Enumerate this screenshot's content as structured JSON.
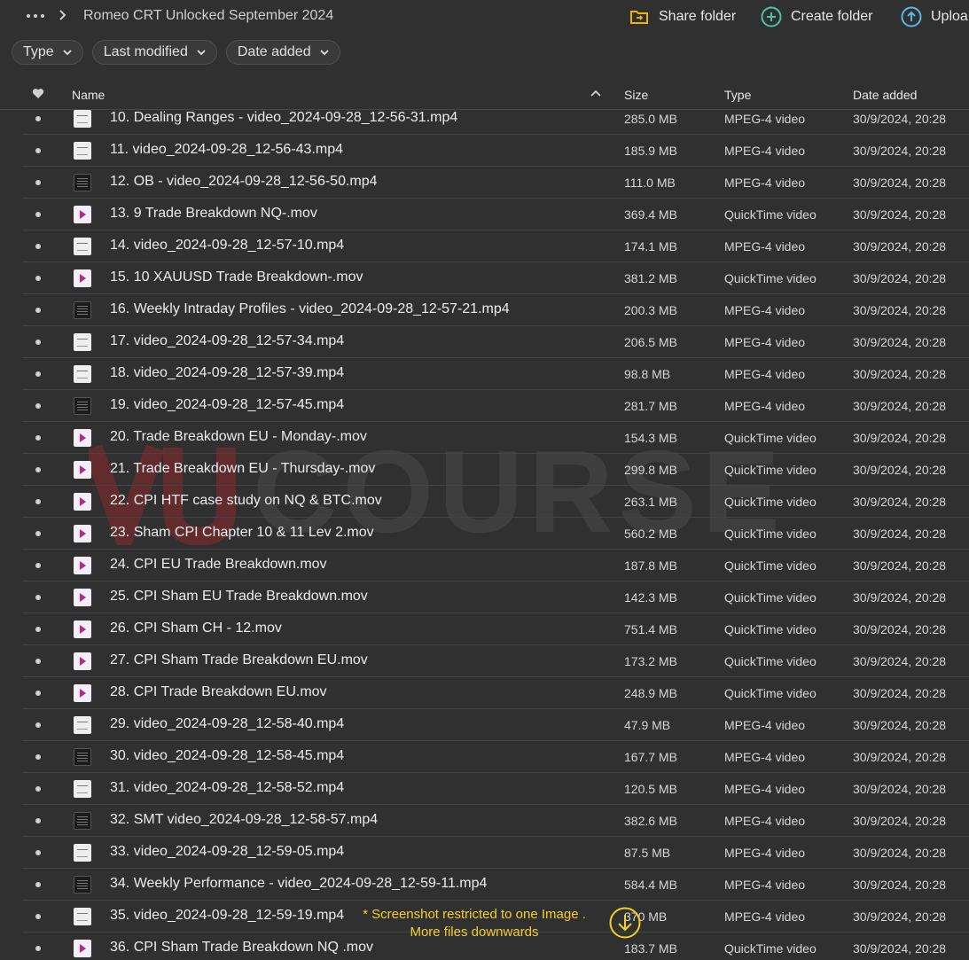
{
  "breadcrumb": {
    "folder_title": "Romeo CRT Unlocked September 2024"
  },
  "actions": {
    "share_folder": "Share folder",
    "create_folder": "Create folder",
    "upload": "Uploa"
  },
  "filters": [
    "Type",
    "Last modified",
    "Date added"
  ],
  "columns": {
    "name": "Name",
    "size": "Size",
    "type": "Type",
    "date_added": "Date added"
  },
  "files": [
    {
      "name": "10. Dealing Ranges - video_2024-09-28_12-56-31.mp4",
      "size": "285.0 MB",
      "type": "MPEG-4 video",
      "date": "30/9/2024, 20:28",
      "thumb": "light"
    },
    {
      "name": "11. video_2024-09-28_12-56-43.mp4",
      "size": "185.9 MB",
      "type": "MPEG-4 video",
      "date": "30/9/2024, 20:28",
      "thumb": "light"
    },
    {
      "name": "12. OB - video_2024-09-28_12-56-50.mp4",
      "size": "111.0 MB",
      "type": "MPEG-4 video",
      "date": "30/9/2024, 20:28",
      "thumb": "dark"
    },
    {
      "name": "13. 9 Trade Breakdown NQ-.mov",
      "size": "369.4 MB",
      "type": "QuickTime video",
      "date": "30/9/2024, 20:28",
      "thumb": "play"
    },
    {
      "name": "14. video_2024-09-28_12-57-10.mp4",
      "size": "174.1 MB",
      "type": "MPEG-4 video",
      "date": "30/9/2024, 20:28",
      "thumb": "light"
    },
    {
      "name": "15. 10 XAUUSD Trade Breakdown-.mov",
      "size": "381.2 MB",
      "type": "QuickTime video",
      "date": "30/9/2024, 20:28",
      "thumb": "play"
    },
    {
      "name": "16. Weekly Intraday Profiles - video_2024-09-28_12-57-21.mp4",
      "size": "200.3 MB",
      "type": "MPEG-4 video",
      "date": "30/9/2024, 20:28",
      "thumb": "dark"
    },
    {
      "name": "17. video_2024-09-28_12-57-34.mp4",
      "size": "206.5 MB",
      "type": "MPEG-4 video",
      "date": "30/9/2024, 20:28",
      "thumb": "light"
    },
    {
      "name": "18. video_2024-09-28_12-57-39.mp4",
      "size": "98.8 MB",
      "type": "MPEG-4 video",
      "date": "30/9/2024, 20:28",
      "thumb": "light"
    },
    {
      "name": "19. video_2024-09-28_12-57-45.mp4",
      "size": "281.7 MB",
      "type": "MPEG-4 video",
      "date": "30/9/2024, 20:28",
      "thumb": "dark"
    },
    {
      "name": "20. Trade Breakdown EU - Monday-.mov",
      "size": "154.3 MB",
      "type": "QuickTime video",
      "date": "30/9/2024, 20:28",
      "thumb": "play"
    },
    {
      "name": "21. Trade Breakdown EU - Thursday-.mov",
      "size": "299.8 MB",
      "type": "QuickTime video",
      "date": "30/9/2024, 20:28",
      "thumb": "play"
    },
    {
      "name": "22. CPI HTF case study on NQ & BTC.mov",
      "size": "263.1 MB",
      "type": "QuickTime video",
      "date": "30/9/2024, 20:28",
      "thumb": "play"
    },
    {
      "name": "23. Sham CPI Chapter 10 & 11 Lev 2.mov",
      "size": "560.2 MB",
      "type": "QuickTime video",
      "date": "30/9/2024, 20:28",
      "thumb": "play"
    },
    {
      "name": "24. CPI EU Trade Breakdown.mov",
      "size": "187.8 MB",
      "type": "QuickTime video",
      "date": "30/9/2024, 20:28",
      "thumb": "play"
    },
    {
      "name": "25. CPI Sham EU Trade Breakdown.mov",
      "size": "142.3 MB",
      "type": "QuickTime video",
      "date": "30/9/2024, 20:28",
      "thumb": "play"
    },
    {
      "name": "26. CPI Sham CH - 12.mov",
      "size": "751.4 MB",
      "type": "QuickTime video",
      "date": "30/9/2024, 20:28",
      "thumb": "play"
    },
    {
      "name": "27. CPI Sham Trade Breakdown EU.mov",
      "size": "173.2 MB",
      "type": "QuickTime video",
      "date": "30/9/2024, 20:28",
      "thumb": "play"
    },
    {
      "name": "28. CPI Trade Breakdown EU.mov",
      "size": "248.9 MB",
      "type": "QuickTime video",
      "date": "30/9/2024, 20:28",
      "thumb": "play"
    },
    {
      "name": "29. video_2024-09-28_12-58-40.mp4",
      "size": "47.9 MB",
      "type": "MPEG-4 video",
      "date": "30/9/2024, 20:28",
      "thumb": "light"
    },
    {
      "name": "30. video_2024-09-28_12-58-45.mp4",
      "size": "167.7 MB",
      "type": "MPEG-4 video",
      "date": "30/9/2024, 20:28",
      "thumb": "dark"
    },
    {
      "name": "31. video_2024-09-28_12-58-52.mp4",
      "size": "120.5 MB",
      "type": "MPEG-4 video",
      "date": "30/9/2024, 20:28",
      "thumb": "light"
    },
    {
      "name": "32. SMT video_2024-09-28_12-58-57.mp4",
      "size": "382.6 MB",
      "type": "MPEG-4 video",
      "date": "30/9/2024, 20:28",
      "thumb": "dark"
    },
    {
      "name": "33. video_2024-09-28_12-59-05.mp4",
      "size": "87.5 MB",
      "type": "MPEG-4 video",
      "date": "30/9/2024, 20:28",
      "thumb": "light"
    },
    {
      "name": "34. Weekly Performance - video_2024-09-28_12-59-11.mp4",
      "size": "584.4 MB",
      "type": "MPEG-4 video",
      "date": "30/9/2024, 20:28",
      "thumb": "dark"
    },
    {
      "name": "35. video_2024-09-28_12-59-19.mp4",
      "size": "370 MB",
      "type": "MPEG-4 video",
      "date": "30/9/2024, 20:28",
      "thumb": "light"
    },
    {
      "name": "36. CPI Sham Trade Breakdown NQ .mov",
      "size": "183.7 MB",
      "type": "QuickTime video",
      "date": "30/9/2024, 20:28",
      "thumb": "play"
    }
  ],
  "watermark": {
    "text": "COURSE"
  },
  "notice": {
    "line1": "* Screenshot restricted to one Image .",
    "line2": "More files downwards"
  },
  "colors": {
    "background": "#303030",
    "notice": "#f2cf2a",
    "share_icon": "#f0b400",
    "create_icon": "#49c3a6",
    "upload_icon": "#5ab6e8",
    "watermark_red": "#c0262d"
  }
}
